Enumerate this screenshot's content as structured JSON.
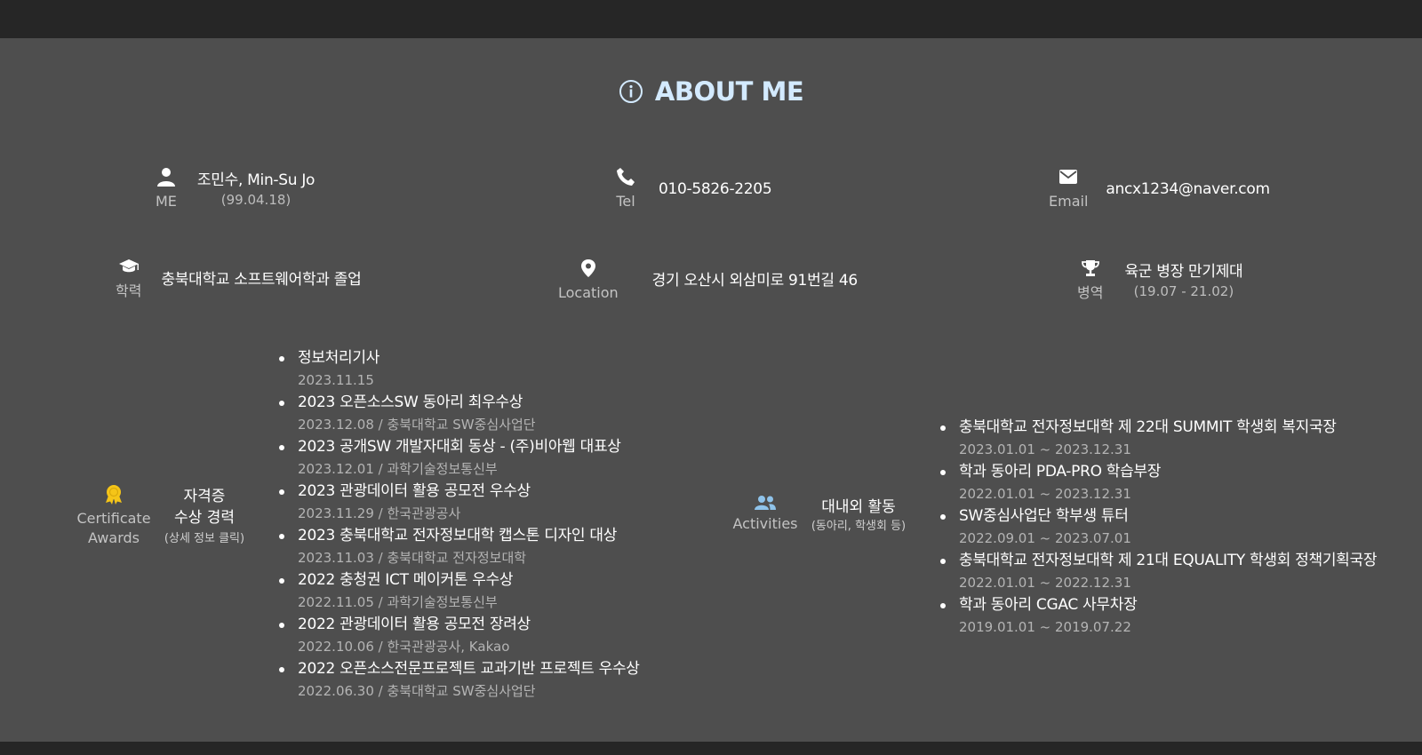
{
  "section": {
    "title": "ABOUT ME",
    "icon": "info-circle-icon",
    "title_color": "#d3eaff"
  },
  "row1": [
    {
      "icon": "person-icon",
      "label": "ME",
      "value": "조민수, Min-Su Jo",
      "sub": "(99.04.18)"
    },
    {
      "icon": "phone-icon",
      "label": "Tel",
      "value": "010-5826-2205"
    },
    {
      "icon": "mail-icon",
      "label": "Email",
      "value": "ancx1234@naver.com"
    }
  ],
  "row2": [
    {
      "icon": "graduation-cap-icon",
      "label": "학력",
      "value": "충북대학교 소프트웨어학과 졸업"
    },
    {
      "icon": "map-pin-icon",
      "label": "Location",
      "value": "경기 오산시 외삼미로 91번길 46"
    },
    {
      "icon": "trophy-icon",
      "label": "병역",
      "value": "육군 병장 만기제대",
      "sub": "(19.07 - 21.02)"
    }
  ],
  "awards": {
    "icon": "award-icon",
    "icon_color": "#f5c518",
    "label_line1": "Certificate",
    "label_line2": "Awards",
    "heading_line1": "자격증",
    "heading_line2": "수상 경력",
    "hint": "(상세 정보 클릭)",
    "items": [
      {
        "title": "정보처리기사",
        "sub": "2023.11.15"
      },
      {
        "title": "2023 오픈소스SW 동아리 최우수상",
        "sub": "2023.12.08 / 충북대학교 SW중심사업단"
      },
      {
        "title": "2023 공개SW 개발자대회 동상 - (주)비아웹 대표상",
        "sub": "2023.12.01 / 과학기술정보통신부"
      },
      {
        "title": "2023 관광데이터 활용 공모전 우수상",
        "sub": "2023.11.29 / 한국관광공사"
      },
      {
        "title": "2023 충북대학교 전자정보대학 캡스톤 디자인 대상",
        "sub": "2023.11.03 / 충북대학교 전자정보대학"
      },
      {
        "title": "2022 충청권 ICT 메이커톤 우수상",
        "sub": "2022.11.05 / 과학기술정보통신부"
      },
      {
        "title": "2022 관광데이터 활용 공모전 장려상",
        "sub": "2022.10.06 / 한국관광공사, Kakao"
      },
      {
        "title": "2022 오픈소스전문프로젝트 교과기반 프로젝트 우수상",
        "sub": "2022.06.30 / 충북대학교 SW중심사업단"
      }
    ]
  },
  "activities": {
    "icon": "people-icon",
    "icon_color": "#8fc3ea",
    "label": "Activities",
    "heading": "대내외 활동",
    "hint": "(동아리, 학생회 등)",
    "items": [
      {
        "title": "충북대학교 전자정보대학 제 22대 SUMMIT 학생회 복지국장",
        "sub": "2023.01.01 ~ 2023.12.31"
      },
      {
        "title": "학과 동아리 PDA-PRO 학습부장",
        "sub": "2022.01.01 ~ 2023.12.31"
      },
      {
        "title": "SW중심사업단 학부생 튜터",
        "sub": "2022.09.01 ~ 2023.07.01"
      },
      {
        "title": "충북대학교 전자정보대학 제 21대 EQUALITY 학생회 정책기획국장",
        "sub": "2022.01.01 ~ 2022.12.31"
      },
      {
        "title": "학과 동아리 CGAC 사무차장",
        "sub": "2019.01.01 ~ 2019.07.22"
      }
    ]
  }
}
